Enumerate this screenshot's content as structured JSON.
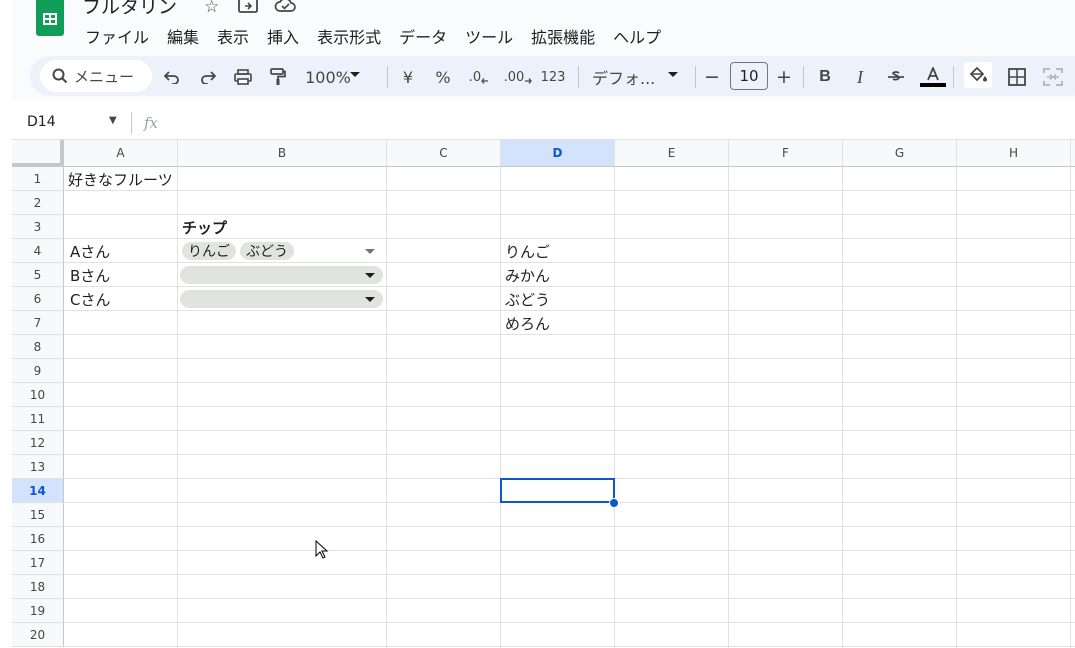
{
  "app": {
    "doc_title": "フルタリン",
    "menu": [
      "ファイル",
      "編集",
      "表示",
      "挿入",
      "表示形式",
      "データ",
      "ツール",
      "拡張機能",
      "ヘルプ"
    ]
  },
  "toolbar": {
    "search_label": "メニュー",
    "zoom": "100%",
    "currency": "¥",
    "percent": "%",
    "decrease_decimal": ".0",
    "increase_decimal": ".00",
    "number_format": "123",
    "font_family": "デフォ...",
    "font_size": "10",
    "minus": "−",
    "plus": "+",
    "bold": "B",
    "italic": "I"
  },
  "formula_bar": {
    "cell_reference": "D14",
    "fx_label": "fx",
    "content": ""
  },
  "columns": [
    "A",
    "B",
    "C",
    "D",
    "E",
    "F",
    "G",
    "H"
  ],
  "selected_column": "D",
  "rows": [
    "1",
    "2",
    "3",
    "4",
    "5",
    "6",
    "7",
    "8",
    "9",
    "10",
    "11",
    "12",
    "13",
    "14",
    "15",
    "16",
    "17",
    "18",
    "19",
    "20"
  ],
  "selected_row": "14",
  "cells": {
    "A1": "好きなフルーツ",
    "B3": "チップ",
    "A4": "Aさん",
    "A5": "Bさん",
    "A6": "Cさん",
    "D4": "りんご",
    "D5": "みかん",
    "D6": "ぶどう",
    "D7": "めろん"
  },
  "chips": {
    "B4": [
      "りんご",
      "ぶどう"
    ]
  },
  "colors": {
    "accent": "#0b57d0",
    "sheets_green": "#0f9d58",
    "chip_bg": "#e1e3e1",
    "selected_header_bg": "#d3e3fd"
  }
}
